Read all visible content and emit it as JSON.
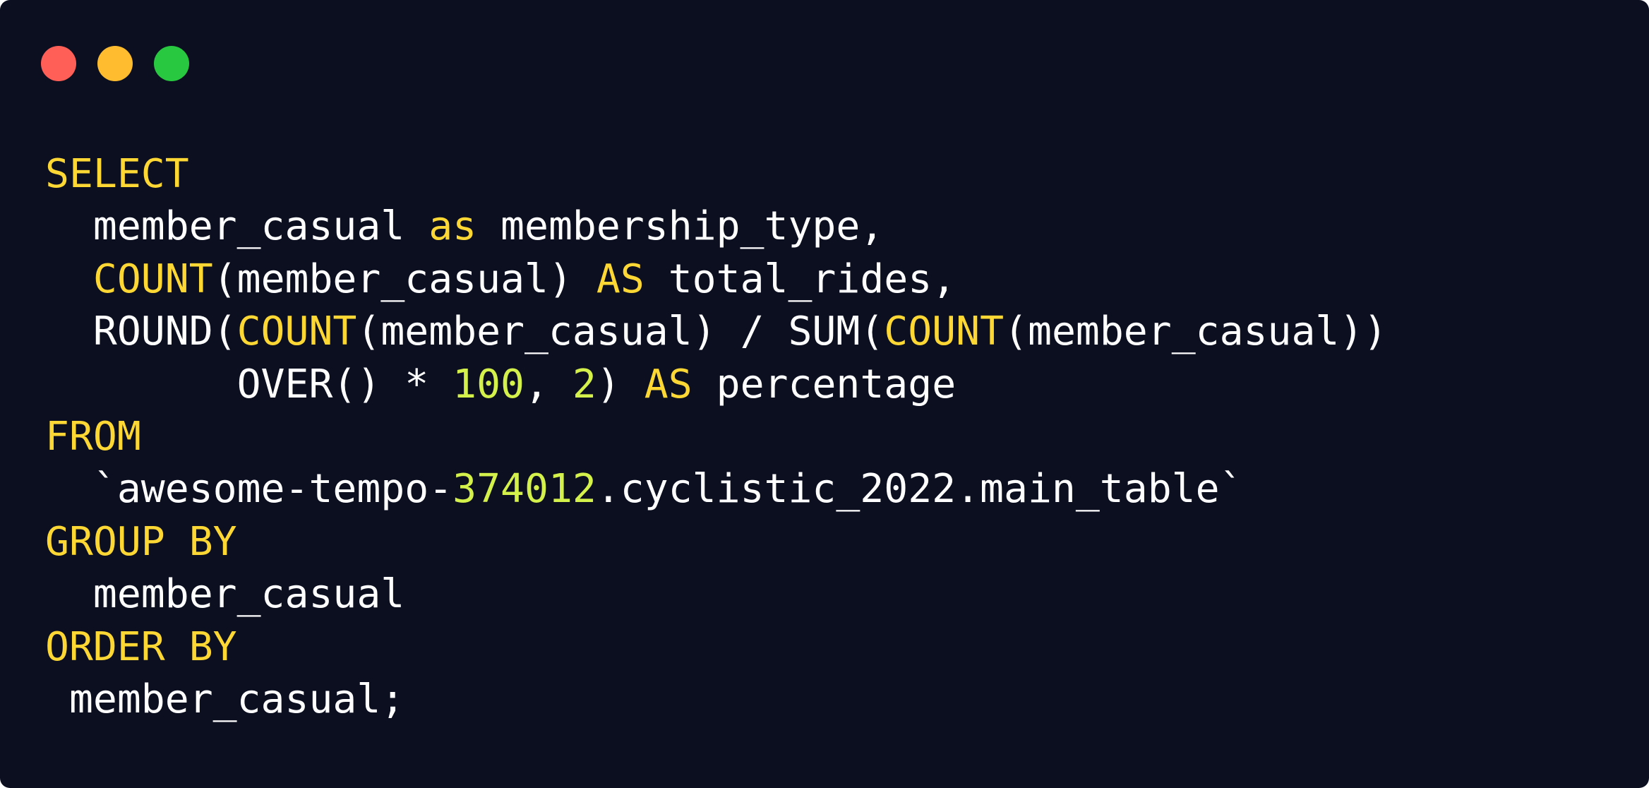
{
  "window": {
    "background": "#0c0f20",
    "buttons": [
      {
        "name": "close",
        "color": "#ff5f57"
      },
      {
        "name": "minimize",
        "color": "#febc2e"
      },
      {
        "name": "zoom",
        "color": "#28c840"
      }
    ]
  },
  "syntax_colors": {
    "plain": "#ffffff",
    "keyword": "#fdd835",
    "number": "#d4f04a"
  },
  "code": {
    "language": "SQL",
    "lines": [
      [
        {
          "t": "SELECT",
          "k": "keyword"
        }
      ],
      [
        {
          "t": "  member_casual ",
          "k": "plain"
        },
        {
          "t": "as",
          "k": "keyword"
        },
        {
          "t": " membership_type,",
          "k": "plain"
        }
      ],
      [
        {
          "t": "  ",
          "k": "plain"
        },
        {
          "t": "COUNT",
          "k": "keyword"
        },
        {
          "t": "(member_casual) ",
          "k": "plain"
        },
        {
          "t": "AS",
          "k": "keyword"
        },
        {
          "t": " total_rides,",
          "k": "plain"
        }
      ],
      [
        {
          "t": "  ROUND(",
          "k": "plain"
        },
        {
          "t": "COUNT",
          "k": "keyword"
        },
        {
          "t": "(member_casual) / SUM(",
          "k": "plain"
        },
        {
          "t": "COUNT",
          "k": "keyword"
        },
        {
          "t": "(member_casual))",
          "k": "plain"
        }
      ],
      [
        {
          "t": "        OVER() * ",
          "k": "plain"
        },
        {
          "t": "100",
          "k": "number"
        },
        {
          "t": ", ",
          "k": "plain"
        },
        {
          "t": "2",
          "k": "number"
        },
        {
          "t": ") ",
          "k": "plain"
        },
        {
          "t": "AS",
          "k": "keyword"
        },
        {
          "t": " percentage",
          "k": "plain"
        }
      ],
      [
        {
          "t": "FROM",
          "k": "keyword"
        }
      ],
      [
        {
          "t": "  `awesome-tempo-",
          "k": "plain"
        },
        {
          "t": "374012",
          "k": "number"
        },
        {
          "t": ".cyclistic_2022.main_table`",
          "k": "plain"
        }
      ],
      [
        {
          "t": "GROUP BY",
          "k": "keyword"
        }
      ],
      [
        {
          "t": "  member_casual",
          "k": "plain"
        }
      ],
      [
        {
          "t": "ORDER BY",
          "k": "keyword"
        }
      ],
      [
        {
          "t": " member_casual;",
          "k": "plain"
        }
      ]
    ]
  }
}
